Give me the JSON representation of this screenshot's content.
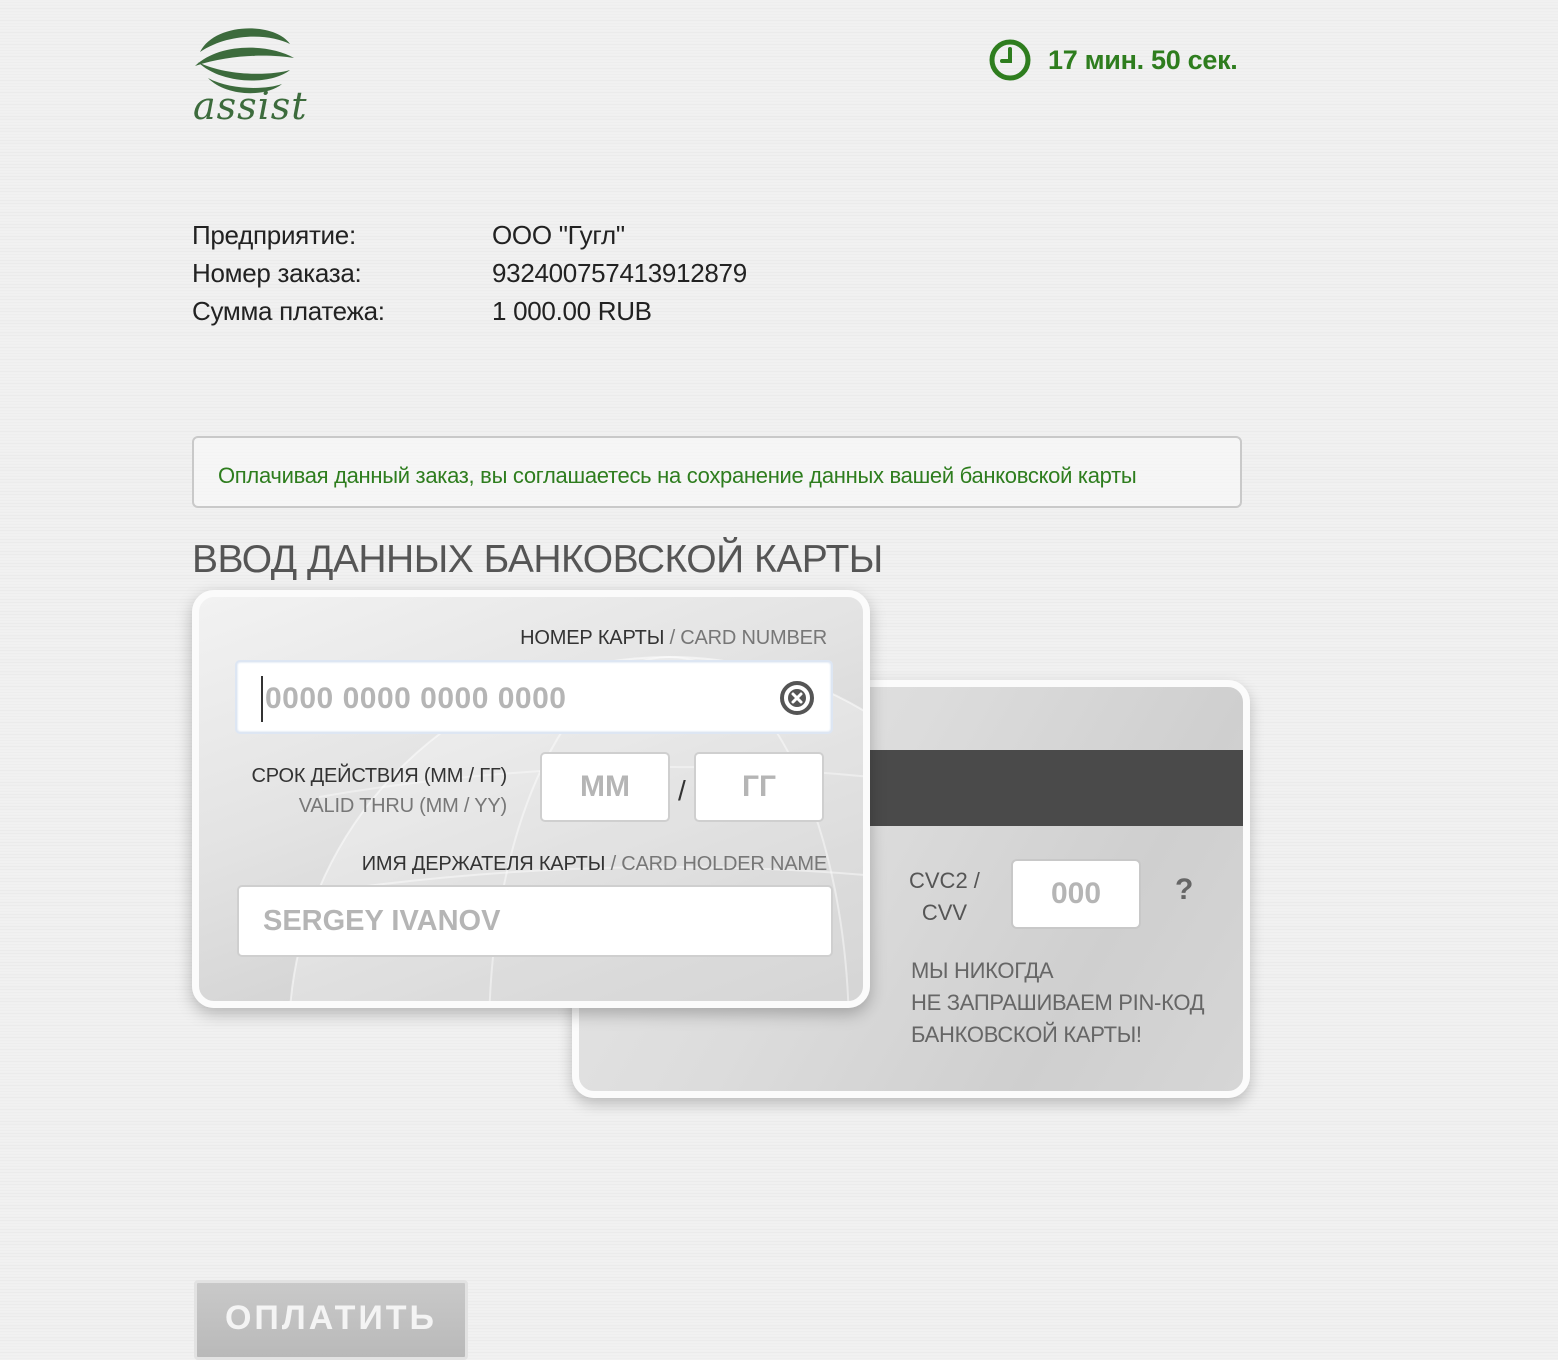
{
  "brand": {
    "logo_text": "assist",
    "green": "#2e7d1e"
  },
  "timer": {
    "icon": "clock-icon",
    "text": "17 мин. 50 сек."
  },
  "order": {
    "rows": [
      {
        "label": "Предприятие:",
        "value": "ООО \"Гугл\""
      },
      {
        "label": "Номер заказа:",
        "value": "932400757413912879"
      },
      {
        "label": "Сумма платежа:",
        "value": "1 000.00 RUB"
      }
    ]
  },
  "notice": "Оплачивая данный заказ, вы соглашаетесь на сохранение данных вашей банковской карты",
  "section_title": "ВВОД ДАННЫХ БАНКОВСКОЙ КАРТЫ",
  "card_front": {
    "card_number_label_ru": "НОМЕР КАРТЫ",
    "card_number_label_en": "/ CARD NUMBER",
    "card_number_placeholder": "0000 0000 0000 0000",
    "card_number_value": "",
    "clear_icon": "clear-circle-icon",
    "expiry_label_ru": "СРОК ДЕЙСТВИЯ (ММ / ГГ)",
    "expiry_label_en": "VALID THRU (MM / YY)",
    "month_placeholder": "ММ",
    "year_placeholder": "ГГ",
    "expiry_separator": "/",
    "holder_label_ru": "ИМЯ ДЕРЖАТЕЛЯ КАРТЫ",
    "holder_label_en": "/ CARD HOLDER NAME",
    "holder_placeholder": "SERGEY IVANOV"
  },
  "card_back": {
    "cvv_label_line1": "CVC2 /",
    "cvv_label_line2": "CVV",
    "cvv_placeholder": "000",
    "help_symbol": "?",
    "pin_note_line1": "МЫ НИКОГДА",
    "pin_note_line2": "НЕ ЗАПРАШИВАЕМ PIN-КОД",
    "pin_note_line3": "БАНКОВСКОЙ КАРТЫ!"
  },
  "pay_button": "ОПЛАТИТЬ"
}
